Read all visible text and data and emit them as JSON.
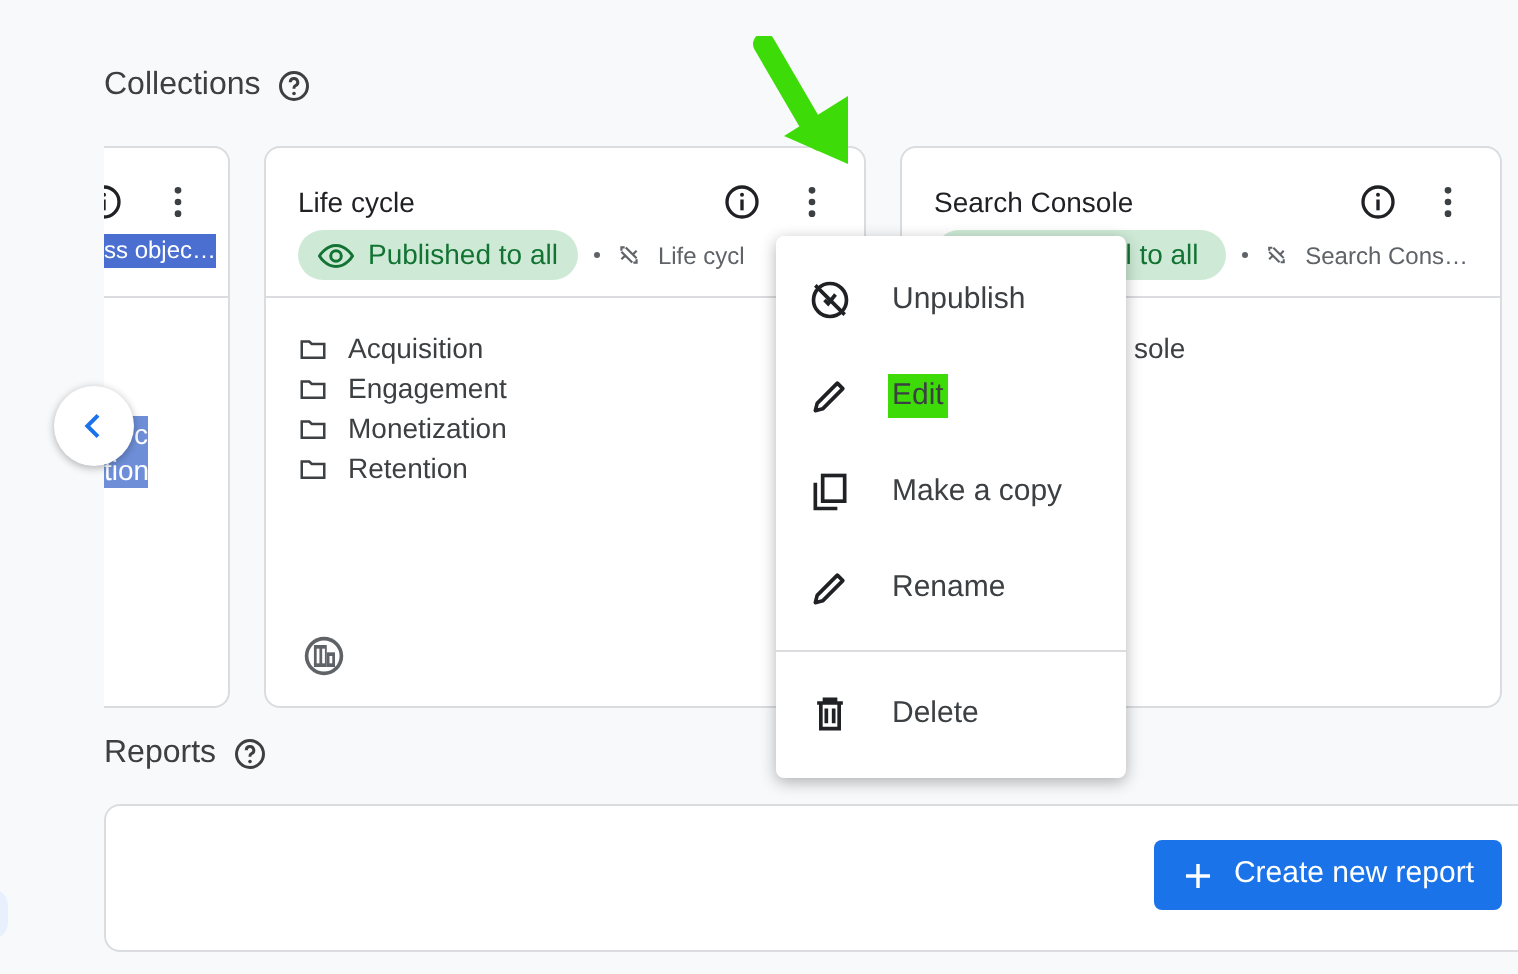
{
  "collections": {
    "title": "Collections"
  },
  "cards": [
    {
      "kind": "partial",
      "tag": "ss objec…",
      "tag_selected": true,
      "lines": [
        "c",
        "tion"
      ],
      "lines_selected": true
    },
    {
      "kind": "full",
      "title": "Life cycle",
      "status": "Published to all",
      "source": "Life cycl",
      "items": [
        "Acquisition",
        "Engagement",
        "Monetization",
        "Retention"
      ]
    },
    {
      "kind": "covered",
      "title": "Search Console",
      "status": "l to all",
      "source": "Search Cons…",
      "items": [
        "sole"
      ]
    }
  ],
  "menu": {
    "items": [
      {
        "label": "Unpublish",
        "highlighted": false,
        "divider_before": false
      },
      {
        "label": "Edit",
        "highlighted": true,
        "divider_before": false
      },
      {
        "label": "Make a copy",
        "highlighted": false,
        "divider_before": false
      },
      {
        "label": "Rename",
        "highlighted": false,
        "divider_before": false
      },
      {
        "label": "Delete",
        "highlighted": false,
        "divider_before": true
      }
    ]
  },
  "reports": {
    "title": "Reports",
    "button": "Create new report"
  }
}
